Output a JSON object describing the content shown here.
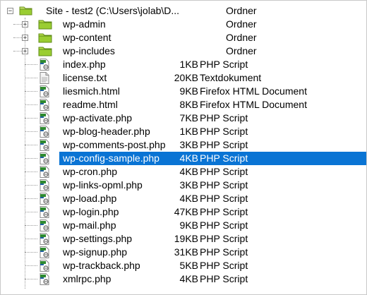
{
  "tree": {
    "root": {
      "label": "Site - test2 (C:\\Users\\jolab\\D...",
      "type": "Ordner",
      "expander": "−"
    },
    "folders": [
      {
        "label": "wp-admin",
        "type": "Ordner",
        "expander": "+"
      },
      {
        "label": "wp-content",
        "type": "Ordner",
        "expander": "+"
      },
      {
        "label": "wp-includes",
        "type": "Ordner",
        "expander": "+"
      }
    ],
    "files": [
      {
        "label": "index.php",
        "size": "1KB",
        "type": "PHP Script",
        "icon": "php-file-icon"
      },
      {
        "label": "license.txt",
        "size": "20KB",
        "type": "Textdokument",
        "icon": "text-file-icon"
      },
      {
        "label": "liesmich.html",
        "size": "9KB",
        "type": "Firefox HTML Document",
        "icon": "html-file-icon"
      },
      {
        "label": "readme.html",
        "size": "8KB",
        "type": "Firefox HTML Document",
        "icon": "html-file-icon"
      },
      {
        "label": "wp-activate.php",
        "size": "7KB",
        "type": "PHP Script",
        "icon": "php-file-icon"
      },
      {
        "label": "wp-blog-header.php",
        "size": "1KB",
        "type": "PHP Script",
        "icon": "php-file-icon"
      },
      {
        "label": "wp-comments-post.php",
        "size": "3KB",
        "type": "PHP Script",
        "icon": "php-file-icon"
      },
      {
        "label": "wp-config-sample.php",
        "size": "4KB",
        "type": "PHP Script",
        "icon": "php-file-icon",
        "selected": true
      },
      {
        "label": "wp-cron.php",
        "size": "4KB",
        "type": "PHP Script",
        "icon": "php-file-icon"
      },
      {
        "label": "wp-links-opml.php",
        "size": "3KB",
        "type": "PHP Script",
        "icon": "php-file-icon"
      },
      {
        "label": "wp-load.php",
        "size": "4KB",
        "type": "PHP Script",
        "icon": "php-file-icon"
      },
      {
        "label": "wp-login.php",
        "size": "47KB",
        "type": "PHP Script",
        "icon": "php-file-icon"
      },
      {
        "label": "wp-mail.php",
        "size": "9KB",
        "type": "PHP Script",
        "icon": "php-file-icon"
      },
      {
        "label": "wp-settings.php",
        "size": "19KB",
        "type": "PHP Script",
        "icon": "php-file-icon"
      },
      {
        "label": "wp-signup.php",
        "size": "31KB",
        "type": "PHP Script",
        "icon": "php-file-icon"
      },
      {
        "label": "wp-trackback.php",
        "size": "5KB",
        "type": "PHP Script",
        "icon": "php-file-icon"
      },
      {
        "label": "xmlrpc.php",
        "size": "4KB",
        "type": "PHP Script",
        "icon": "php-file-icon"
      }
    ]
  },
  "colors": {
    "selection": "#0a74d4",
    "folder": "#9acd32",
    "php_accent": "#3a8f2c"
  }
}
